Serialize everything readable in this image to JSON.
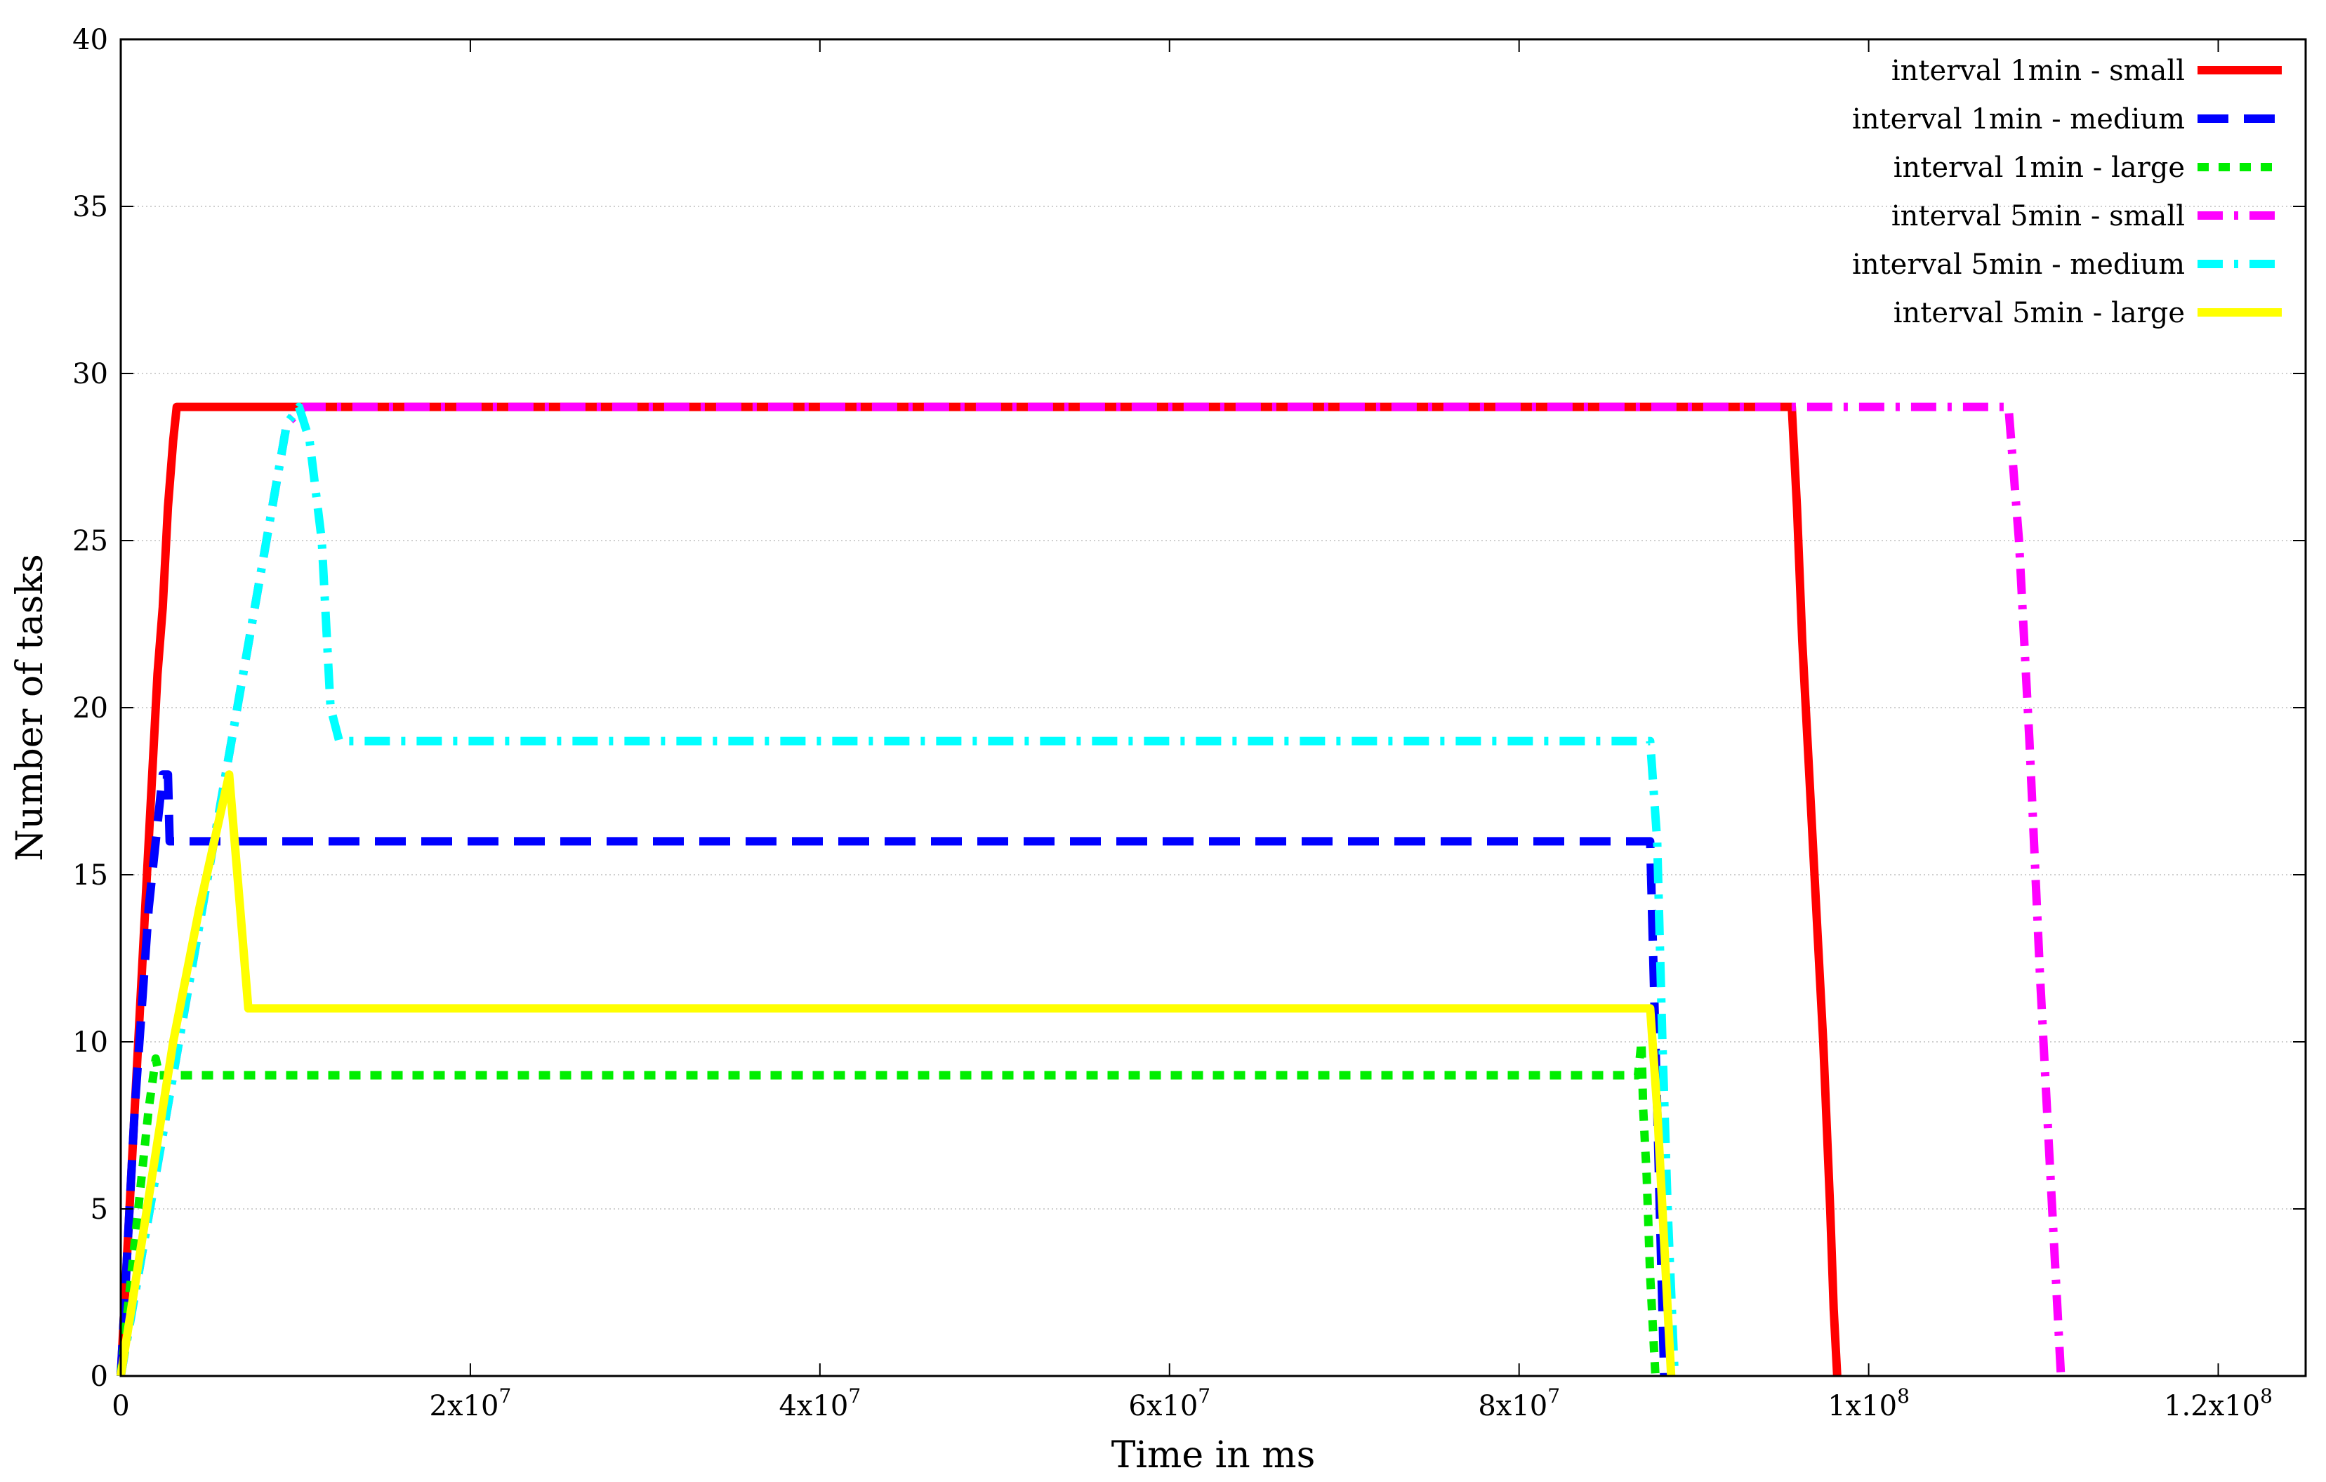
{
  "chart_data": {
    "type": "line",
    "title": "",
    "xlabel": "Time in ms",
    "ylabel": "Number of tasks",
    "xlim": [
      0,
      125000000
    ],
    "ylim": [
      0,
      40
    ],
    "grid": "horizontal dotted",
    "legend_position": "top-right",
    "x_ticks": [
      {
        "value": 0,
        "label": "0"
      },
      {
        "value": 20000000,
        "label": "2x10",
        "exp": "7"
      },
      {
        "value": 40000000,
        "label": "4x10",
        "exp": "7"
      },
      {
        "value": 60000000,
        "label": "6x10",
        "exp": "7"
      },
      {
        "value": 80000000,
        "label": "8x10",
        "exp": "7"
      },
      {
        "value": 100000000,
        "label": "1x10",
        "exp": "8"
      },
      {
        "value": 120000000,
        "label": "1.2x10",
        "exp": "8"
      }
    ],
    "y_ticks": [
      {
        "value": 0,
        "label": "0"
      },
      {
        "value": 5,
        "label": "5"
      },
      {
        "value": 10,
        "label": "10"
      },
      {
        "value": 15,
        "label": "15"
      },
      {
        "value": 20,
        "label": "20"
      },
      {
        "value": 25,
        "label": "25"
      },
      {
        "value": 30,
        "label": "30"
      },
      {
        "value": 35,
        "label": "35"
      },
      {
        "value": 40,
        "label": "40"
      }
    ],
    "series": [
      {
        "name": "interval 1min - small",
        "color": "#ff0000",
        "dash": "solid",
        "x": [
          0,
          300000,
          600000,
          900000,
          1200000,
          1500000,
          1800000,
          2100000,
          2400000,
          2700000,
          3000000,
          3200000,
          95600000,
          95900000,
          96200000,
          96600000,
          97000000,
          97400000,
          97800000,
          98000000,
          98200000
        ],
        "y": [
          0,
          3,
          6,
          9,
          12,
          15,
          18,
          21,
          23,
          26,
          28,
          29,
          29,
          26,
          22,
          18,
          14,
          10,
          5,
          2,
          0
        ]
      },
      {
        "name": "interval 1min - medium",
        "color": "#0000ff",
        "dash": "dashed",
        "x": [
          0,
          400000,
          800000,
          1200000,
          1600000,
          2000000,
          2400000,
          2700000,
          2800000,
          3000000,
          87500000,
          87700000,
          87900000,
          88100000,
          88300000
        ],
        "y": [
          0,
          4,
          8,
          11,
          14,
          16,
          18,
          18,
          16,
          16,
          16,
          12,
          8,
          4,
          0
        ]
      },
      {
        "name": "interval 1min - large",
        "color": "#00ee00",
        "dash": "dotted",
        "x": [
          0,
          400000,
          800000,
          1200000,
          1600000,
          2000000,
          2200000,
          86800000,
          87000000,
          87100000,
          87300000,
          87500000,
          87700000,
          87800000
        ],
        "y": [
          0,
          2,
          4,
          6,
          8,
          9.5,
          9,
          9,
          10,
          8,
          6,
          3,
          1,
          0
        ]
      },
      {
        "name": "interval 5min - small",
        "color": "#ff00ff",
        "dash": "dash-dot",
        "x": [
          0,
          2000000,
          4000000,
          6000000,
          8000000,
          9500000,
          10500000,
          108000000,
          108600000,
          109200000,
          109800000,
          110400000,
          111000000
        ],
        "y": [
          0,
          6,
          12,
          18,
          24,
          28.5,
          29,
          29,
          25,
          19,
          12,
          6,
          0
        ]
      },
      {
        "name": "interval 5min - medium",
        "color": "#00ffff",
        "dash": "dash-dot",
        "x": [
          0,
          2000000,
          4000000,
          6000000,
          8000000,
          9500000,
          10200000,
          10800000,
          11500000,
          12000000,
          12500000,
          87500000,
          87900000,
          88200000,
          88500000,
          88900000
        ],
        "y": [
          0,
          6,
          12,
          18,
          24,
          28.5,
          29,
          28,
          25,
          20,
          19,
          19,
          16,
          10,
          5,
          0
        ]
      },
      {
        "name": "interval 5min - large",
        "color": "#ffff00",
        "dash": "solid",
        "x": [
          0,
          1500000,
          3000000,
          4500000,
          6200000,
          7300000,
          87500000,
          87900000,
          88300000,
          88700000
        ],
        "y": [
          0,
          5,
          10,
          14,
          18,
          11,
          11,
          8,
          4,
          0
        ]
      }
    ]
  }
}
